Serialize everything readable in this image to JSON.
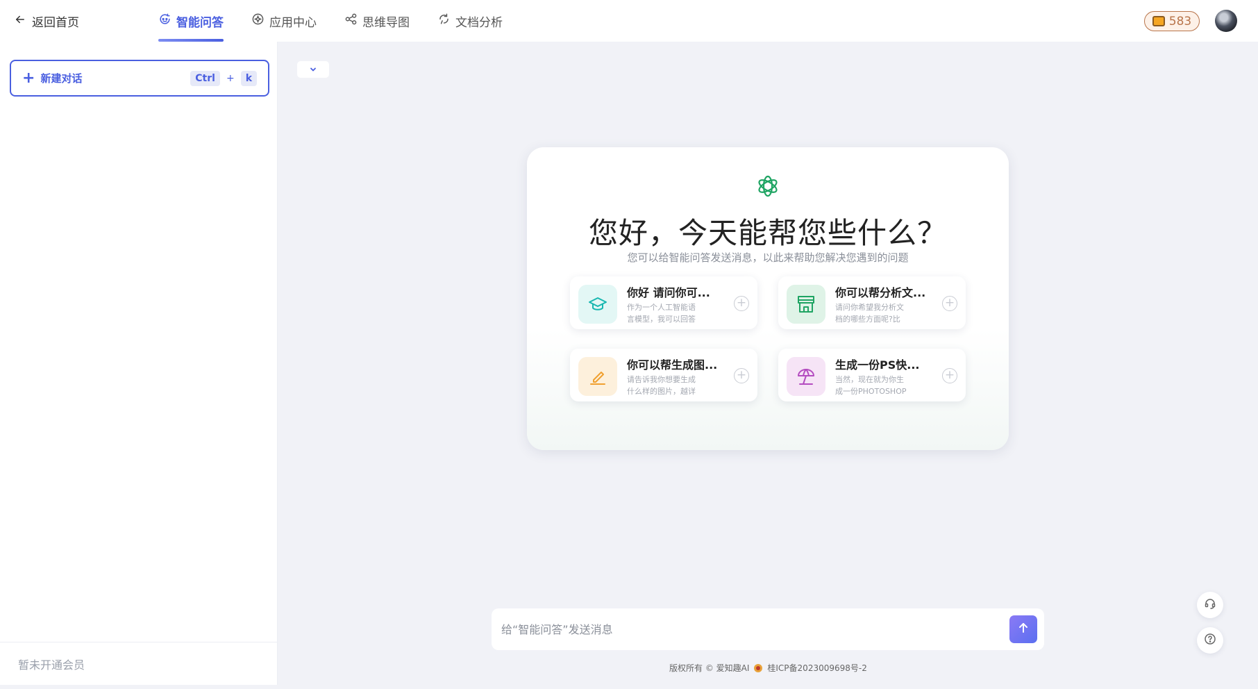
{
  "header": {
    "back_label": "返回首页",
    "nav": [
      {
        "label": "智能问答",
        "icon": "chat-refresh-icon",
        "active": true
      },
      {
        "label": "应用中心",
        "icon": "app-center-icon",
        "active": false
      },
      {
        "label": "思维导图",
        "icon": "mindmap-icon",
        "active": false
      },
      {
        "label": "文档分析",
        "icon": "document-analysis-icon",
        "active": false
      }
    ],
    "coins": "583",
    "accent_color": "#4a5fe0"
  },
  "sidebar": {
    "new_chat_label": "新建对话",
    "shortcut_ctrl": "Ctrl",
    "shortcut_plus": "+",
    "shortcut_key": "k",
    "footer_text": "暂未开通会员"
  },
  "main": {
    "headline": "您好，今天能帮您些什么？",
    "subline": "您可以给智能问答发送消息，以此来帮助您解决您遇到的问题",
    "suggestions": [
      {
        "title": "你好 请问你可...",
        "desc": "作为一个人工智能语言模型，我可以回答你的问...",
        "icon": "graduation-cap-icon",
        "color": "#18b7b0",
        "bg": "#e3f7f5"
      },
      {
        "title": "你可以帮分析文...",
        "desc": "请问你希望我分析文档的哪些方面呢?比如文档的...",
        "icon": "storefront-icon",
        "color": "#1fa463",
        "bg": "#dff3e7"
      },
      {
        "title": "你可以帮生成图...",
        "desc": "请告诉我你想要生成什么样的图片，越详细越好...",
        "icon": "pencil-icon",
        "color": "#f0a030",
        "bg": "#fdf0dc"
      },
      {
        "title": "生成一份PS快...",
        "desc": "当然，现在就为你生成一份PHOTOSHOP快捷键...",
        "icon": "umbrella-icon",
        "color": "#b44cc0",
        "bg": "#f6e4f6"
      }
    ]
  },
  "input": {
    "placeholder": "给“智能问答”发送消息"
  },
  "footer": {
    "copyright": "版权所有 © 爱知趣AI",
    "icp": "桂ICP备2023009698号-2"
  }
}
